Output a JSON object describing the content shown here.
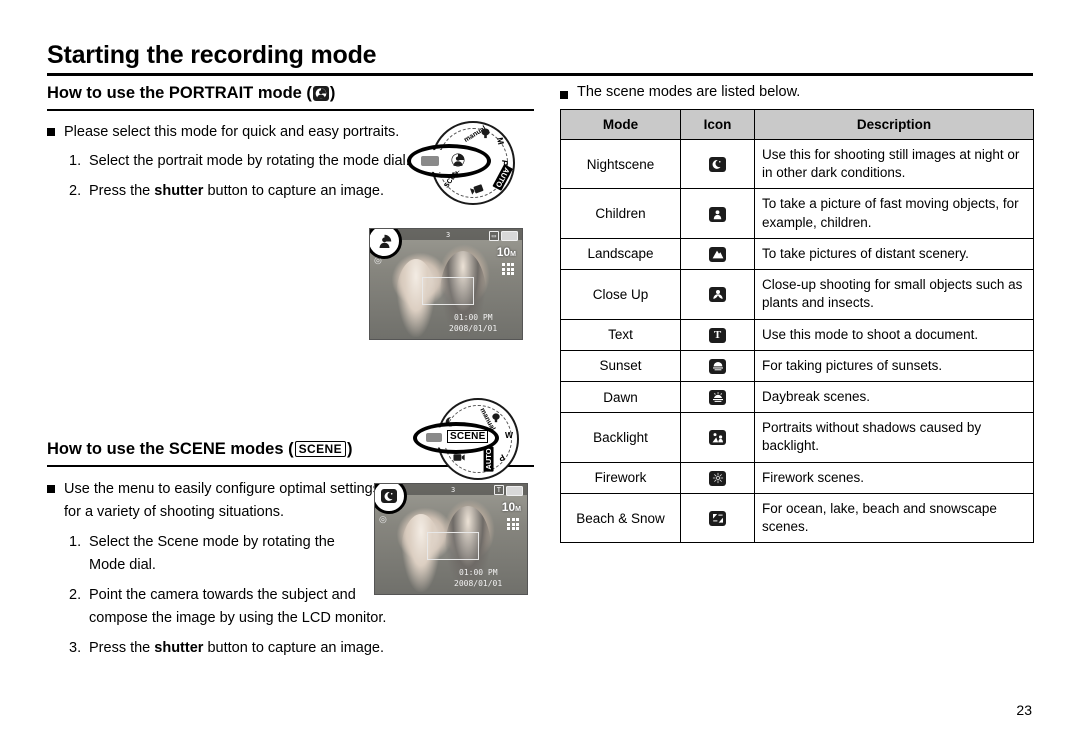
{
  "header": {
    "title": "Starting the recording mode",
    "page_number": "23"
  },
  "portrait_section": {
    "heading_text": "How to use the PORTRAIT mode (",
    "heading_close": ")",
    "heading_icon": "portrait-icon",
    "bullet": "Please select this mode for quick and easy portraits.",
    "steps": [
      {
        "num": "1.",
        "before": "Select the portrait mode by rotating the mode dial.",
        "bold": "",
        "after": ""
      },
      {
        "num": "2.",
        "before": "Press the ",
        "bold": "shutter",
        "after": " button to capture an image."
      }
    ],
    "dial": {
      "selected_label": "",
      "selected_icon": "portrait-icon",
      "items": [
        "manual",
        "M",
        "P",
        "AUTO",
        "movie",
        "SCENE",
        "night",
        "portrait"
      ]
    },
    "lcd": {
      "mode_icon": "portrait-icon",
      "zoom_bar_value": "3",
      "resolution": "10",
      "resolution_unit": "M",
      "time": "01:00 PM",
      "date": "2008/01/01"
    }
  },
  "scene_section": {
    "heading_prefix": "How to use the SCENE modes (",
    "heading_tag": "SCENE",
    "heading_close": ")",
    "bullet_line1": "Use the menu to easily configure optimal settings",
    "bullet_line2": "for a variety of shooting situations.",
    "steps": [
      {
        "num": "1.",
        "before": "Select the Scene mode by rotating the",
        "bold": "",
        "after": "",
        "line2": "Mode dial."
      },
      {
        "num": "2.",
        "before": "Point the camera towards the subject and",
        "bold": "",
        "after": "",
        "line2": "compose the image by using the LCD monitor."
      },
      {
        "num": "3.",
        "before": "Press the ",
        "bold": "shutter",
        "after": " button to capture an image.",
        "line2": ""
      }
    ],
    "dial": {
      "selected_label": "SCENE",
      "items": [
        "manual",
        "M",
        "P",
        "AUTO",
        "movie",
        "SCENE",
        "night",
        "portrait"
      ]
    },
    "lcd": {
      "mode_icon": "nightscene-icon",
      "zoom_bar_value": "3",
      "resolution": "10",
      "resolution_unit": "M",
      "time": "01:00 PM",
      "date": "2008/01/01"
    }
  },
  "scene_table": {
    "intro": "The scene modes are listed below.",
    "columns": [
      "Mode",
      "Icon",
      "Description"
    ],
    "rows": [
      {
        "mode": "Nightscene",
        "icon": "nightscene-moon-icon",
        "desc": "Use this for shooting still images at night or in other dark conditions."
      },
      {
        "mode": "Children",
        "icon": "children-icon",
        "desc": "To take a picture of fast moving objects, for example, children."
      },
      {
        "mode": "Landscape",
        "icon": "landscape-icon",
        "desc": "To take pictures of distant scenery."
      },
      {
        "mode": "Close Up",
        "icon": "closeup-flower-icon",
        "desc": "Close-up shooting for small objects such as plants and insects."
      },
      {
        "mode": "Text",
        "icon": "text-icon",
        "desc": "Use this mode to shoot a document."
      },
      {
        "mode": "Sunset",
        "icon": "sunset-icon",
        "desc": "For taking pictures of sunsets."
      },
      {
        "mode": "Dawn",
        "icon": "dawn-icon",
        "desc": "Daybreak scenes."
      },
      {
        "mode": "Backlight",
        "icon": "backlight-icon",
        "desc": "Portraits without shadows caused by backlight."
      },
      {
        "mode": "Firework",
        "icon": "firework-icon",
        "desc": "Firework scenes."
      },
      {
        "mode": "Beach & Snow",
        "icon": "beach-snow-icon",
        "desc": "For ocean, lake, beach and snowscape scenes."
      }
    ]
  },
  "colors": {
    "table_header_bg": "#c9c9c9",
    "rule": "#000000",
    "icon_bg": "#1c1c1c"
  }
}
